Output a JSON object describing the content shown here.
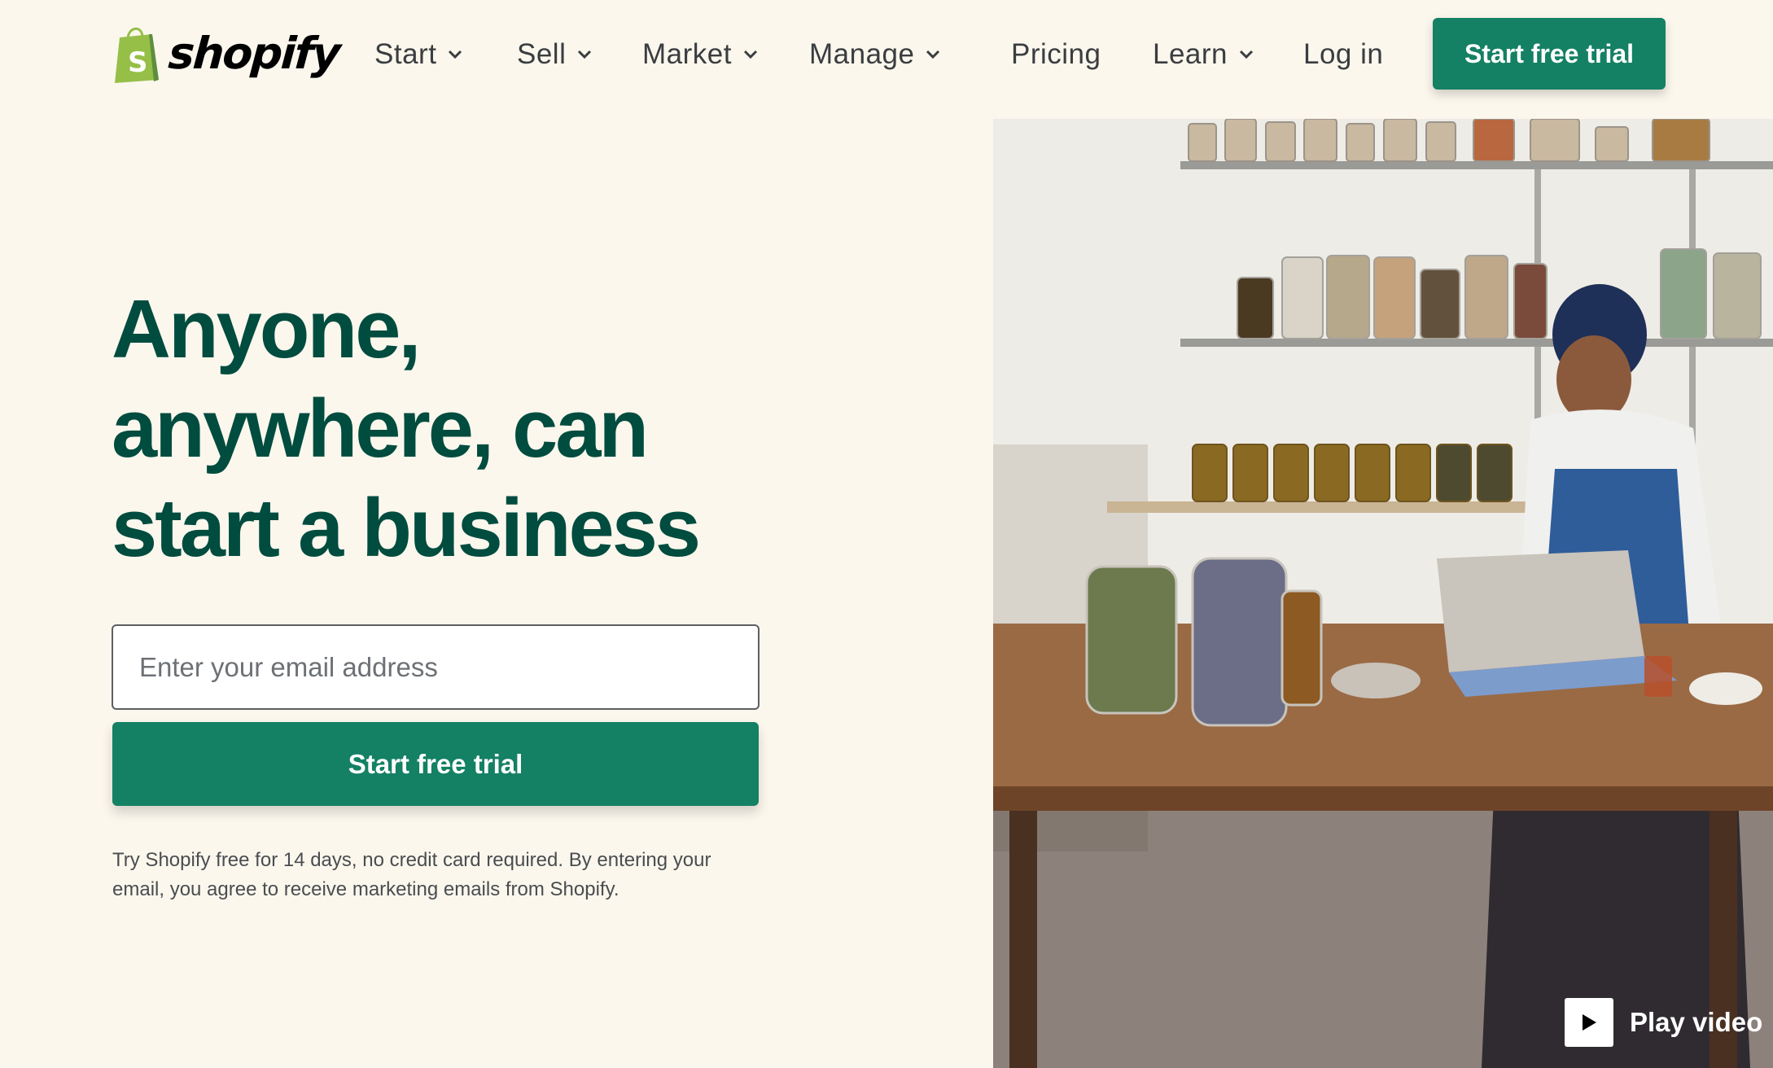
{
  "brand": {
    "name": "shopify",
    "accent": "#148064",
    "headline_color": "#004c3f",
    "bag_color": "#95bf47"
  },
  "nav": {
    "items": [
      {
        "label": "Start",
        "dropdown": true
      },
      {
        "label": "Sell",
        "dropdown": true
      },
      {
        "label": "Market",
        "dropdown": true
      },
      {
        "label": "Manage",
        "dropdown": true
      },
      {
        "label": "Pricing",
        "dropdown": false
      },
      {
        "label": "Learn",
        "dropdown": true
      },
      {
        "label": "Log in",
        "dropdown": false
      }
    ],
    "cta_label": "Start free trial"
  },
  "hero": {
    "headline_lines": [
      "Anyone,",
      "anywhere, can",
      "start a business"
    ],
    "email_placeholder": "Enter your email address",
    "cta_label": "Start free trial",
    "disclaimer": "Try Shopify free for 14 days, no credit card required. By entering your email, you agree to receive marketing emails from Shopify.",
    "video_label": "Play video",
    "icons": [
      "shopping-bag-logo-icon",
      "chevron-down-icon",
      "play-icon"
    ]
  }
}
